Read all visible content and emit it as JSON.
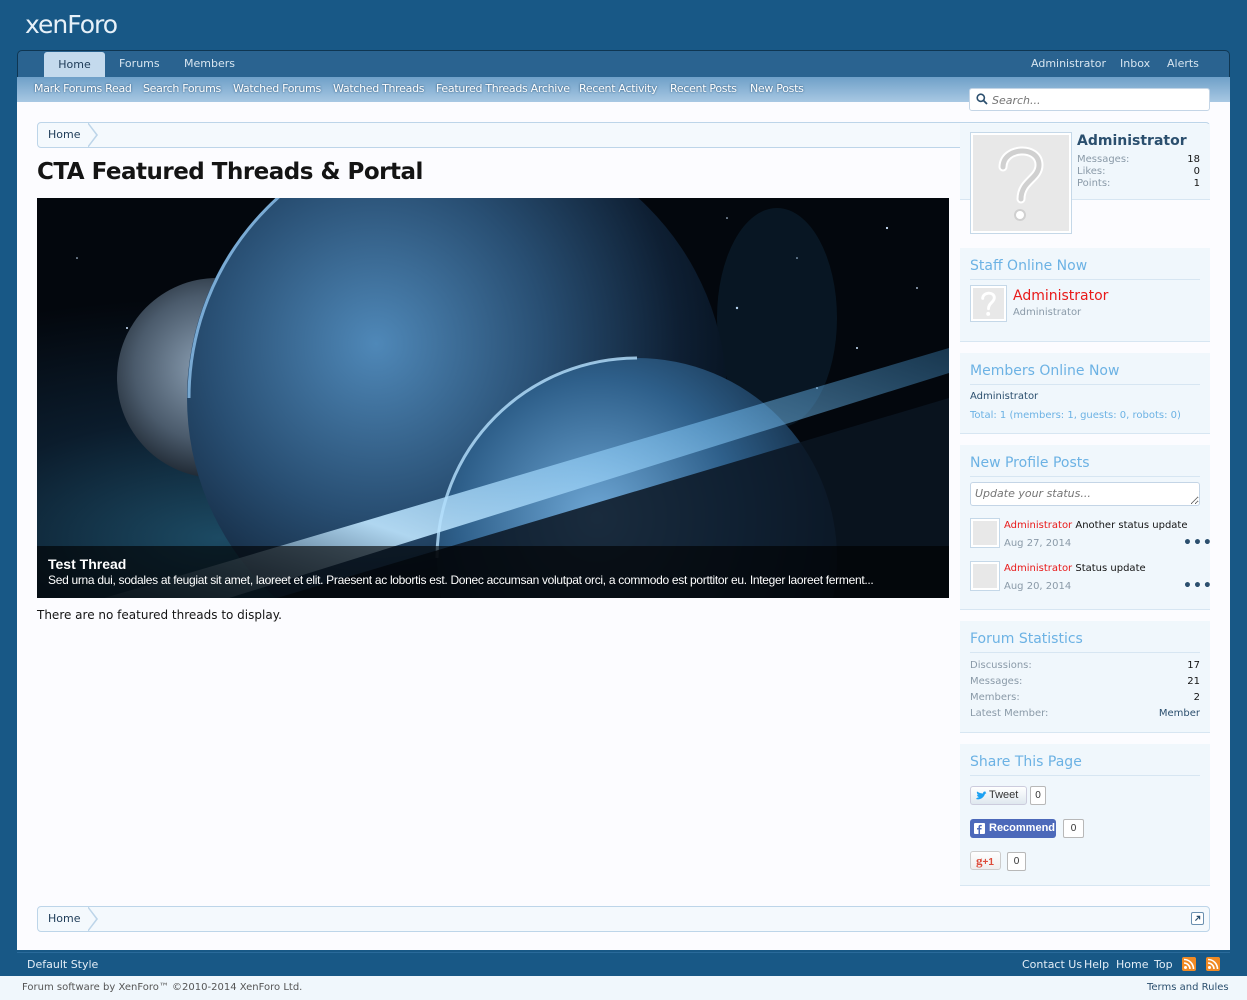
{
  "logo": {
    "text_a": "xen",
    "text_b": "Foro"
  },
  "nav": {
    "tabs": [
      {
        "label": "Home"
      },
      {
        "label": "Forums"
      },
      {
        "label": "Members"
      }
    ],
    "account": {
      "user": "Administrator",
      "inbox": "Inbox",
      "alerts": "Alerts"
    }
  },
  "subnav": {
    "items": [
      {
        "label": "Mark Forums Read"
      },
      {
        "label": "Search Forums"
      },
      {
        "label": "Watched Forums"
      },
      {
        "label": "Watched Threads"
      },
      {
        "label": "Featured Threads Archive"
      },
      {
        "label": "Recent Activity"
      },
      {
        "label": "Recent Posts"
      },
      {
        "label": "New Posts"
      }
    ]
  },
  "search": {
    "placeholder": "Search..."
  },
  "breadcrumb": {
    "home": "Home"
  },
  "page": {
    "title": "CTA Featured Threads & Portal",
    "no_featured": "There are no featured threads to display."
  },
  "slider": {
    "title": "Test Thread",
    "text": "Sed urna dui, sodales at feugiat sit amet, laoreet et elit. Praesent ac lobortis est. Donec accumsan volutpat orci, a commodo est porttitor eu. Integer laoreet ferment..."
  },
  "visitor": {
    "name": "Administrator",
    "stats": [
      {
        "label": "Messages:",
        "value": "18"
      },
      {
        "label": "Likes:",
        "value": "0"
      },
      {
        "label": "Points:",
        "value": "1"
      }
    ]
  },
  "staff_online": {
    "heading": "Staff Online Now",
    "name": "Administrator",
    "title": "Administrator"
  },
  "members_online": {
    "heading": "Members Online Now",
    "list": "Administrator",
    "total": "Total: 1 (members: 1, guests: 0, robots: 0)"
  },
  "profile_posts": {
    "heading": "New Profile Posts",
    "placeholder": "Update your status...",
    "posts": [
      {
        "author": "Administrator",
        "text": "Another status update",
        "date": "Aug 27, 2014"
      },
      {
        "author": "Administrator",
        "text": "Status update",
        "date": "Aug 20, 2014"
      }
    ],
    "more": "•••"
  },
  "forum_stats": {
    "heading": "Forum Statistics",
    "rows": [
      {
        "label": "Discussions:",
        "value": "17"
      },
      {
        "label": "Messages:",
        "value": "21"
      },
      {
        "label": "Members:",
        "value": "2"
      },
      {
        "label": "Latest Member:",
        "value": "Member"
      }
    ]
  },
  "share": {
    "heading": "Share This Page",
    "tweet": {
      "label": "Tweet",
      "count": "0"
    },
    "facebook": {
      "label": "Recommend",
      "count": "0"
    },
    "gplus": {
      "label": "+1",
      "count": "0"
    }
  },
  "footer": {
    "style": "Default Style",
    "links": [
      {
        "label": "Contact Us"
      },
      {
        "label": "Help"
      },
      {
        "label": "Home"
      },
      {
        "label": "Top"
      }
    ],
    "copyright": "Forum software by XenForo™ ©2010-2014 XenForo Ltd.",
    "terms": "Terms and Rules"
  },
  "colors": {
    "brand_dark": "#185886",
    "accent_light": "#6cb2e4",
    "staff_red": "#e81a1a"
  }
}
